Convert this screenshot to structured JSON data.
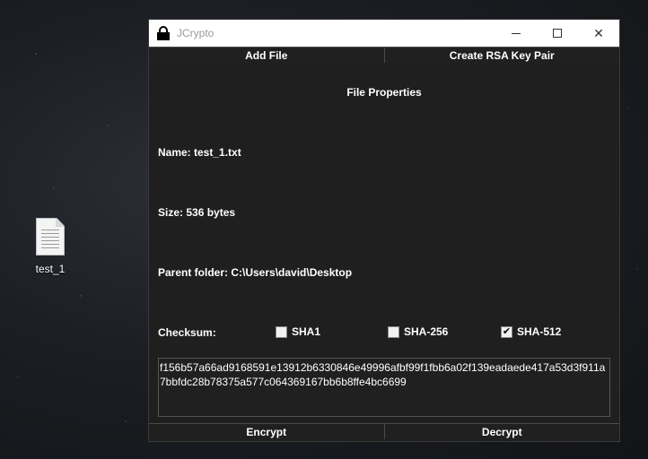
{
  "desktop": {
    "file_icon_label": "test_1"
  },
  "window": {
    "title": "JCrypto",
    "controls": {
      "minimize": "minimize",
      "maximize": "maximize",
      "close": "✕"
    },
    "top_buttons": {
      "add_file": "Add File",
      "create_rsa": "Create RSA Key Pair"
    },
    "section_title": "File Properties",
    "properties": {
      "name": "Name: test_1.txt",
      "size": "Size: 536 bytes",
      "parent_folder": "Parent folder: C:\\Users\\david\\Desktop"
    },
    "checksum": {
      "label": "Checksum:",
      "options": [
        {
          "label": "SHA1",
          "checked": false
        },
        {
          "label": "SHA-256",
          "checked": false
        },
        {
          "label": "SHA-512",
          "checked": true
        }
      ],
      "value": "f156b57a66ad9168591e13912b6330846e49996afbf99f1fbb6a02f139eadaede417a53d3f911a7bbfdc28b78375a577c064369167bb6b8ffe4bc6699"
    },
    "bottom_buttons": {
      "encrypt": "Encrypt",
      "decrypt": "Decrypt"
    }
  },
  "icons": {
    "lock": "lock-icon",
    "file": "text-file-icon",
    "check": "✔"
  }
}
